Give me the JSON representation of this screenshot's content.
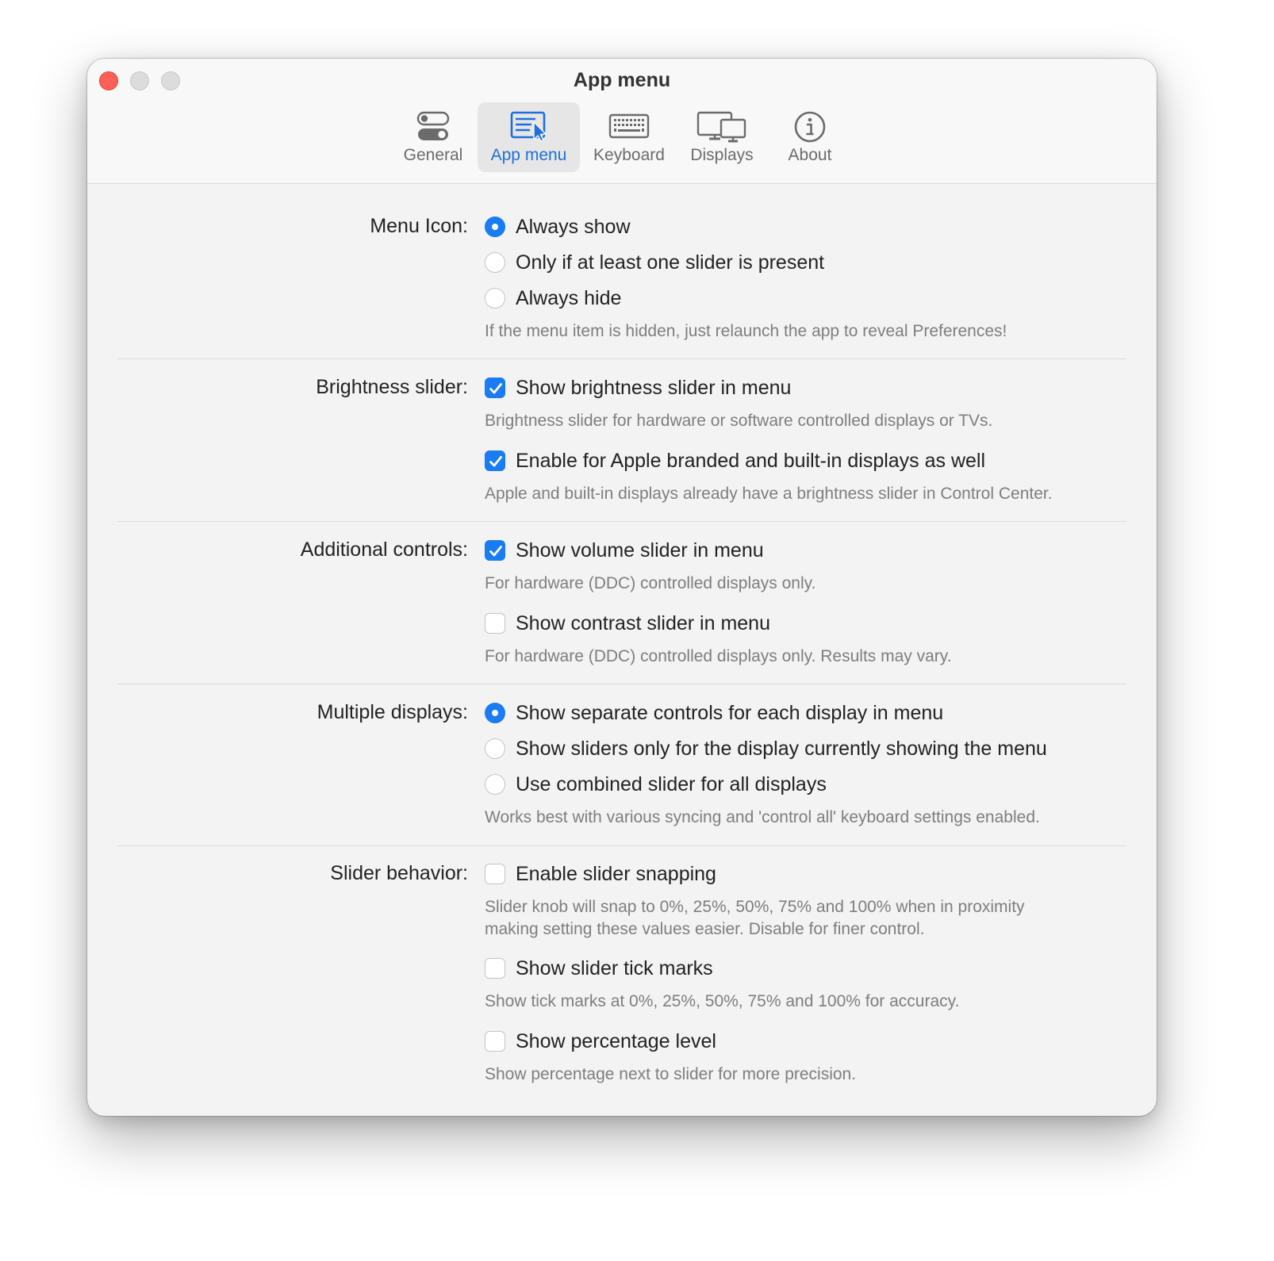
{
  "window": {
    "title": "App menu"
  },
  "toolbar": {
    "tabs": [
      {
        "label": "General",
        "icon": "toggles-icon",
        "selected": false
      },
      {
        "label": "App menu",
        "icon": "menu-cursor-icon",
        "selected": true
      },
      {
        "label": "Keyboard",
        "icon": "keyboard-icon",
        "selected": false
      },
      {
        "label": "Displays",
        "icon": "displays-icon",
        "selected": false
      },
      {
        "label": "About",
        "icon": "info-icon",
        "selected": false
      }
    ]
  },
  "colors": {
    "accent": "#1a7cf4",
    "close_button": "#fe5f57",
    "selected_tab_text": "#1e6fdc"
  },
  "sections": {
    "menu_icon": {
      "label": "Menu Icon:",
      "options": [
        {
          "label": "Always show",
          "checked": true
        },
        {
          "label": "Only if at least one slider is present",
          "checked": false
        },
        {
          "label": "Always hide",
          "checked": false
        }
      ],
      "hint": "If the menu item is hidden, just relaunch the app to reveal Preferences!"
    },
    "brightness": {
      "label": "Brightness slider:",
      "show_slider": {
        "label": "Show brightness slider in menu",
        "checked": true
      },
      "show_slider_hint": "Brightness slider for hardware or software controlled displays or TVs.",
      "apple_displays": {
        "label": "Enable for Apple branded and built-in displays as well",
        "checked": true
      },
      "apple_displays_hint": "Apple and built-in displays already have a brightness slider in Control Center."
    },
    "additional": {
      "label": "Additional controls:",
      "volume": {
        "label": "Show volume slider in menu",
        "checked": true
      },
      "volume_hint": "For hardware (DDC) controlled displays only.",
      "contrast": {
        "label": "Show contrast slider in menu",
        "checked": false
      },
      "contrast_hint": "For hardware (DDC) controlled displays only. Results may vary."
    },
    "multiple": {
      "label": "Multiple displays:",
      "options": [
        {
          "label": "Show separate controls for each display in menu",
          "checked": true
        },
        {
          "label": "Show sliders only for the display currently showing the menu",
          "checked": false
        },
        {
          "label": "Use combined slider for all displays",
          "checked": false
        }
      ],
      "hint": "Works best with various syncing and 'control all' keyboard settings enabled."
    },
    "slider_behavior": {
      "label": "Slider behavior:",
      "snapping": {
        "label": "Enable slider snapping",
        "checked": false
      },
      "snapping_hint_line1": "Slider knob will snap to 0%, 25%, 50%, 75% and 100% when in proximity",
      "snapping_hint_line2": "making setting these values easier. Disable for finer control.",
      "tick_marks": {
        "label": "Show slider tick marks",
        "checked": false
      },
      "tick_marks_hint": "Show tick marks at 0%, 25%, 50%, 75% and 100% for accuracy.",
      "percentage": {
        "label": "Show percentage level",
        "checked": false
      },
      "percentage_hint": "Show percentage next to slider for more precision."
    }
  }
}
